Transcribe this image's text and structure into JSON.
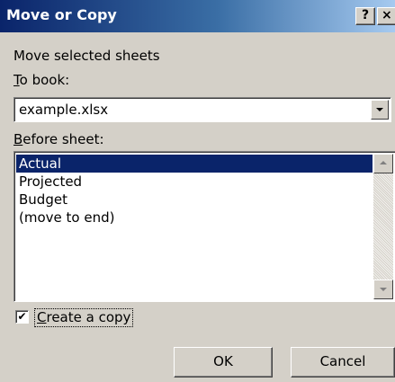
{
  "dialog": {
    "title": "Move or Copy",
    "help_label": "?",
    "close_label": "×"
  },
  "instruction": "Move selected sheets",
  "to_book": {
    "label": "To book:",
    "value": "example.xlsx"
  },
  "before_sheet": {
    "label": "Before sheet:",
    "items": [
      "Actual",
      "Projected",
      "Budget",
      "(move to end)"
    ],
    "selected": "Actual"
  },
  "create_copy": {
    "label": "Create a copy",
    "checked": true,
    "mark": "✔"
  },
  "buttons": {
    "ok": "OK",
    "cancel": "Cancel"
  },
  "icons": {
    "combo_arrow": "chevron-down-icon",
    "scroll_up": "scroll-up-icon",
    "scroll_down": "scroll-down-icon"
  },
  "colors": {
    "title_bar_start": "#0a246a",
    "title_bar_end": "#a6caf0",
    "selection": "#0a246a",
    "face": "#d4d0c8"
  }
}
